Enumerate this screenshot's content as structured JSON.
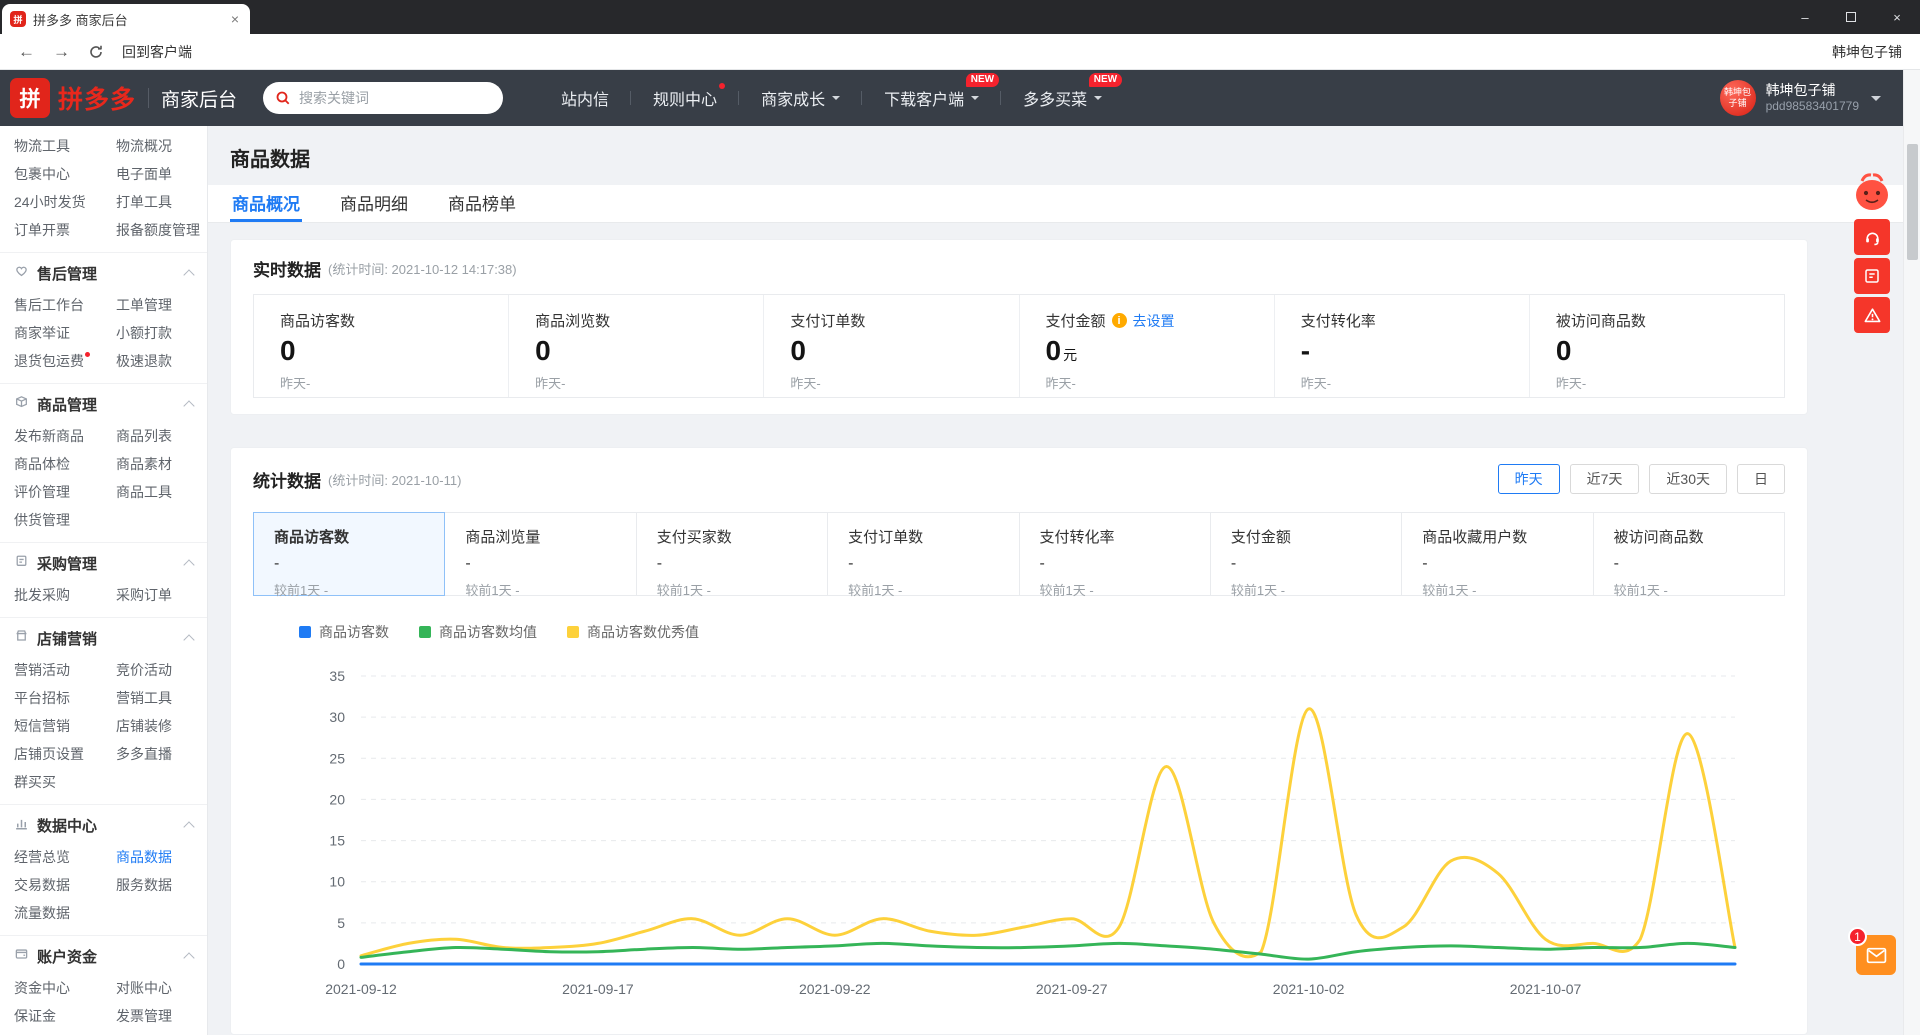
{
  "browser": {
    "tab_title": "拼多多 商家后台",
    "back_to_client": "回到客户端",
    "shop_name_toolbar": "韩坤包子铺"
  },
  "navbar": {
    "brand": "拼多多",
    "console": "商家后台",
    "search_placeholder": "搜索关键词",
    "menu": [
      {
        "label": "站内信"
      },
      {
        "label": "规则中心",
        "dot": true
      },
      {
        "label": "商家成长",
        "caret": true
      },
      {
        "label": "下载客户端",
        "caret": true,
        "badge": "NEW"
      },
      {
        "label": "多多买菜",
        "caret": true,
        "badge": "NEW"
      }
    ],
    "user": {
      "shop": "韩坤包子铺",
      "account": "pdd98583401779",
      "avatar_text": "韩坤包子铺"
    }
  },
  "sidebar": {
    "groups": [
      {
        "items": [
          {
            "label": "物流工具"
          },
          {
            "label": "物流概况"
          },
          {
            "label": "包裹中心"
          },
          {
            "label": "电子面单"
          },
          {
            "label": "24小时发货"
          },
          {
            "label": "打单工具"
          },
          {
            "label": "订单开票"
          },
          {
            "label": "报备额度管理"
          }
        ]
      },
      {
        "title": "售后管理",
        "icon": "aftersale-icon",
        "items": [
          {
            "label": "售后工作台"
          },
          {
            "label": "工单管理"
          },
          {
            "label": "商家举证"
          },
          {
            "label": "小额打款"
          },
          {
            "label": "退货包运费",
            "dot": true
          },
          {
            "label": "极速退款"
          }
        ]
      },
      {
        "title": "商品管理",
        "icon": "goods-icon",
        "items": [
          {
            "label": "发布新商品"
          },
          {
            "label": "商品列表"
          },
          {
            "label": "商品体检"
          },
          {
            "label": "商品素材"
          },
          {
            "label": "评价管理"
          },
          {
            "label": "商品工具"
          },
          {
            "label": "供货管理"
          }
        ]
      },
      {
        "title": "采购管理",
        "icon": "purchase-icon",
        "items": [
          {
            "label": "批发采购"
          },
          {
            "label": "采购订单"
          }
        ]
      },
      {
        "title": "店铺营销",
        "icon": "marketing-icon",
        "items": [
          {
            "label": "营销活动"
          },
          {
            "label": "竞价活动"
          },
          {
            "label": "平台招标"
          },
          {
            "label": "营销工具"
          },
          {
            "label": "短信营销"
          },
          {
            "label": "店铺装修"
          },
          {
            "label": "店铺页设置"
          },
          {
            "label": "多多直播"
          },
          {
            "label": "群买买"
          }
        ]
      },
      {
        "title": "数据中心",
        "icon": "data-icon",
        "items": [
          {
            "label": "经营总览"
          },
          {
            "label": "商品数据",
            "active": true
          },
          {
            "label": "交易数据"
          },
          {
            "label": "服务数据"
          },
          {
            "label": "流量数据"
          }
        ]
      },
      {
        "title": "账户资金",
        "icon": "funds-icon",
        "items": [
          {
            "label": "资金中心"
          },
          {
            "label": "对账中心"
          },
          {
            "label": "保证金"
          },
          {
            "label": "发票管理"
          }
        ]
      }
    ]
  },
  "page": {
    "title": "商品数据",
    "tabs": [
      {
        "label": "商品概况",
        "active": true
      },
      {
        "label": "商品明细"
      },
      {
        "label": "商品榜单"
      }
    ]
  },
  "realtime": {
    "title": "实时数据",
    "subtitle": "(统计时间: 2021-10-12 14:17:38)",
    "metrics": [
      {
        "label": "商品访客数",
        "value": "0",
        "sub": "昨天-"
      },
      {
        "label": "商品浏览数",
        "value": "0",
        "sub": "昨天-"
      },
      {
        "label": "支付订单数",
        "value": "0",
        "sub": "昨天-"
      },
      {
        "label": "支付金额",
        "value": "0",
        "unit": "元",
        "sub": "昨天-",
        "info": true,
        "link": "去设置"
      },
      {
        "label": "支付转化率",
        "value": "-",
        "sub": "昨天-"
      },
      {
        "label": "被访问商品数",
        "value": "0",
        "sub": "昨天-"
      }
    ]
  },
  "stats": {
    "title": "统计数据",
    "subtitle": "(统计时间: 2021-10-11)",
    "periods": [
      {
        "label": "昨天",
        "active": true
      },
      {
        "label": "近7天"
      },
      {
        "label": "近30天"
      },
      {
        "label": "日"
      }
    ],
    "cells": [
      {
        "label": "商品访客数",
        "value": "-",
        "sub": "较前1天 -",
        "active": true
      },
      {
        "label": "商品浏览量",
        "value": "-",
        "sub": "较前1天 -"
      },
      {
        "label": "支付买家数",
        "value": "-",
        "sub": "较前1天 -"
      },
      {
        "label": "支付订单数",
        "value": "-",
        "sub": "较前1天 -"
      },
      {
        "label": "支付转化率",
        "value": "-",
        "sub": "较前1天 -"
      },
      {
        "label": "支付金额",
        "value": "-",
        "sub": "较前1天 -"
      },
      {
        "label": "商品收藏用户数",
        "value": "-",
        "sub": "较前1天 -"
      },
      {
        "label": "被访问商品数",
        "value": "-",
        "sub": "较前1天 -"
      }
    ]
  },
  "chart_data": {
    "type": "line",
    "x": [
      "2021-09-12",
      "2021-09-13",
      "2021-09-14",
      "2021-09-15",
      "2021-09-16",
      "2021-09-17",
      "2021-09-18",
      "2021-09-19",
      "2021-09-20",
      "2021-09-21",
      "2021-09-22",
      "2021-09-23",
      "2021-09-24",
      "2021-09-25",
      "2021-09-26",
      "2021-09-27",
      "2021-09-28",
      "2021-09-29",
      "2021-09-30",
      "2021-10-01",
      "2021-10-02",
      "2021-10-03",
      "2021-10-04",
      "2021-10-05",
      "2021-10-06",
      "2021-10-07",
      "2021-10-08",
      "2021-10-09",
      "2021-10-10",
      "2021-10-11"
    ],
    "x_tick_labels": [
      "2021-09-12",
      "2021-09-17",
      "2021-09-22",
      "2021-09-27",
      "2021-10-02",
      "2021-10-07"
    ],
    "ylim": [
      0,
      35
    ],
    "y_ticks": [
      0,
      5,
      10,
      15,
      20,
      25,
      30,
      35
    ],
    "grid": "horizontal-dashed",
    "legend_position": "top-left",
    "series": [
      {
        "name": "商品访客数",
        "color": "#1f7bf4",
        "values": [
          0,
          0,
          0,
          0,
          0,
          0,
          0,
          0,
          0,
          0,
          0,
          0,
          0,
          0,
          0,
          0,
          0,
          0,
          0,
          0,
          0,
          0,
          0,
          0,
          0,
          0,
          0,
          0,
          0,
          0
        ]
      },
      {
        "name": "商品访客数均值",
        "color": "#35b558",
        "values": [
          0.8,
          1.5,
          2,
          1.8,
          1.5,
          1.5,
          1.8,
          2,
          1.8,
          2,
          2.2,
          2.5,
          2.2,
          2,
          2,
          2.2,
          2.5,
          2.2,
          1.8,
          1.2,
          0.6,
          1.5,
          2,
          2.2,
          2,
          1.8,
          2,
          2,
          2.5,
          2
        ]
      },
      {
        "name": "商品访客数优秀值",
        "color": "#fdd13b",
        "values": [
          1,
          2.5,
          3,
          2,
          2,
          2.5,
          4,
          5.5,
          3.5,
          5.5,
          3.5,
          5.5,
          4,
          3.5,
          4.5,
          5.5,
          4.5,
          24,
          5,
          1.5,
          31,
          6,
          4.5,
          12.5,
          11,
          3,
          2.5,
          3,
          28,
          2
        ]
      }
    ]
  },
  "floating": {
    "mail_badge": "1"
  }
}
